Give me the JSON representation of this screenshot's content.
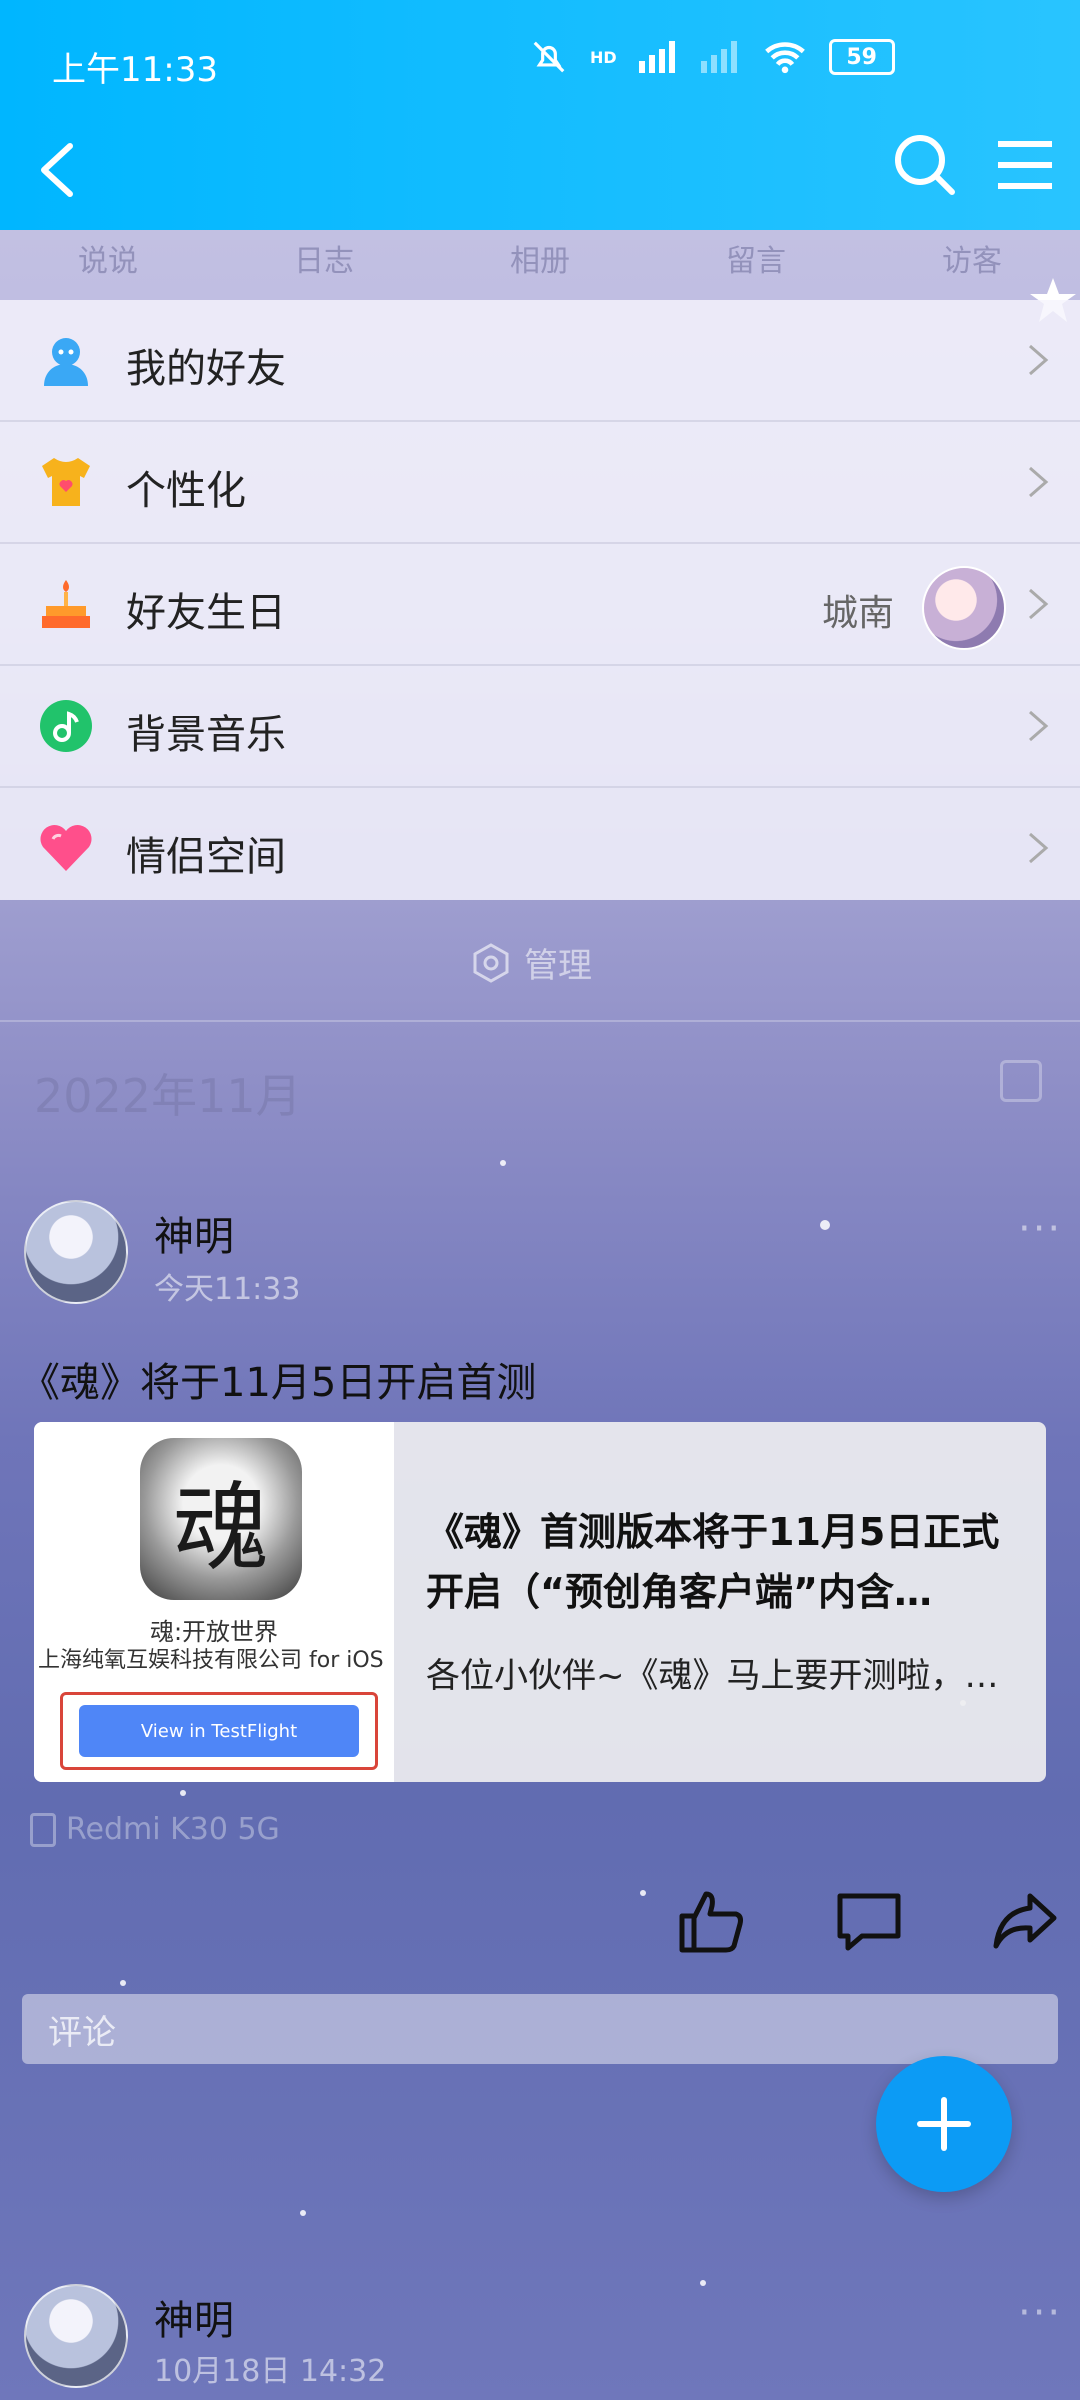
{
  "status_bar": {
    "time": "上午11:33",
    "battery": "59",
    "hd_label": "HD"
  },
  "tabs": [
    "说说",
    "日志",
    "相册",
    "留言",
    "访客"
  ],
  "menu": [
    {
      "label": "我的好友",
      "icon": "friends-icon"
    },
    {
      "label": "个性化",
      "icon": "shirt-icon"
    },
    {
      "label": "好友生日",
      "icon": "cake-icon",
      "right_text": "城南"
    },
    {
      "label": "背景音乐",
      "icon": "music-icon"
    },
    {
      "label": "情侣空间",
      "icon": "heart-icon"
    }
  ],
  "manage_label": "管理",
  "month_label": "2022年11月",
  "posts": [
    {
      "author": "神明",
      "time": "今天11:33",
      "text": "《魂》将于11月5日开启首测",
      "card": {
        "thumb_title": "魂:开放世界",
        "thumb_subtitle": "上海纯氧互娱科技有限公司 for iOS",
        "thumb_button": "View in TestFlight",
        "title": "《魂》首测版本将于11月5日正式开启（“预创角客户端”内含…",
        "desc": "各位小伙伴~《魂》马上要开测啦，…"
      },
      "device": "Redmi K30 5G"
    },
    {
      "author": "神明",
      "time": "10月18日 14:32"
    }
  ],
  "comment_placeholder": "评论",
  "colors": {
    "header_blue": "#00b6ff",
    "fab_blue": "#0c9bf5"
  }
}
